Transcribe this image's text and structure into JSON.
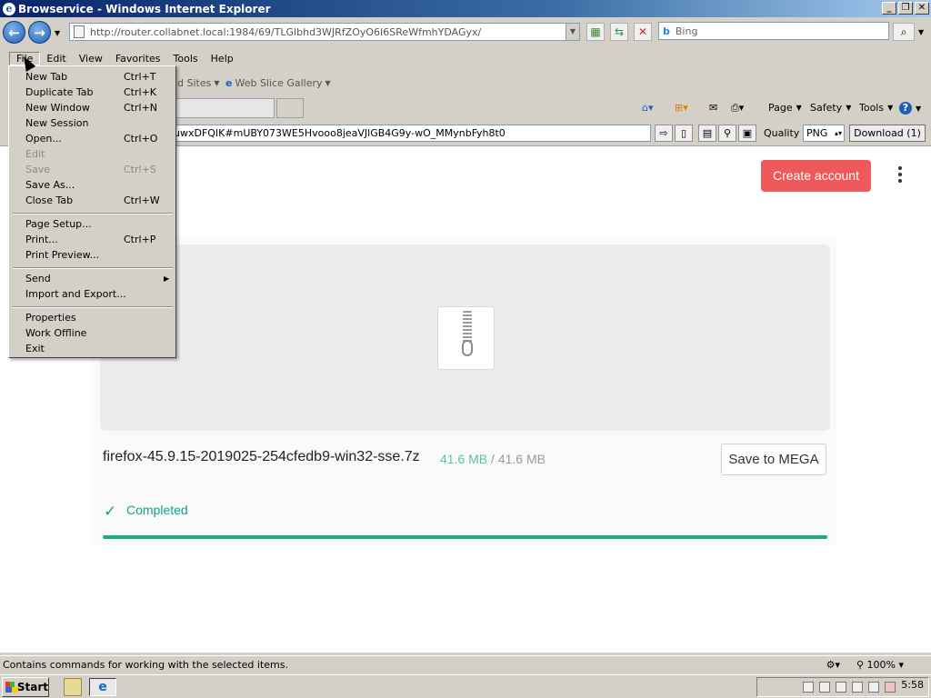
{
  "window": {
    "title": "Browservice - Windows Internet Explorer",
    "ie_letter": "e"
  },
  "address": {
    "url_host": "http://router.collabnet.local",
    "url_path": ":1984/69/TLGlbhd3WJRfZOyO6I6SReWfmhYDAGyx/"
  },
  "search": {
    "placeholder": "Bing"
  },
  "menubar": [
    "File",
    "Edit",
    "View",
    "Favorites",
    "Tools",
    "Help"
  ],
  "favorites": {
    "suggested_sites": "d Sites",
    "web_slice": "Web Slice Gallery"
  },
  "command": {
    "page": "Page",
    "safety": "Safety",
    "tools": "Tools",
    "help": "?"
  },
  "plugin": {
    "url": "uwxDFQIK#mUBY073WE5Hvooo8jeaVJlGB4G9y-wO_MMynbFyh8t0",
    "quality_label": "Quality",
    "quality_value": "PNG",
    "download_label": "Download (1)"
  },
  "page": {
    "create_account": "Create account",
    "filename": "firefox-45.9.15-2019025-254cfedb9-win32-sse.7z",
    "size_done": "41.6 MB",
    "size_sep": " / ",
    "size_total": "41.6 MB",
    "save_to_mega": "Save to MEGA",
    "status": "Completed",
    "progress_fraction": 1.0
  },
  "file_menu": {
    "items": [
      {
        "label": "New Tab",
        "shortcut": "Ctrl+T"
      },
      {
        "label": "Duplicate Tab",
        "shortcut": "Ctrl+K"
      },
      {
        "label": "New Window",
        "shortcut": "Ctrl+N"
      },
      {
        "label": "New Session",
        "shortcut": ""
      },
      {
        "label": "Open...",
        "shortcut": "Ctrl+O"
      },
      {
        "label": "Edit",
        "shortcut": ""
      },
      {
        "label": "Save",
        "shortcut": "Ctrl+S"
      },
      {
        "label": "Save As...",
        "shortcut": ""
      },
      {
        "label": "Close Tab",
        "shortcut": "Ctrl+W"
      },
      {
        "label": "Page Setup...",
        "shortcut": ""
      },
      {
        "label": "Print...",
        "shortcut": "Ctrl+P"
      },
      {
        "label": "Print Preview...",
        "shortcut": ""
      },
      {
        "label": "Send",
        "shortcut": ""
      },
      {
        "label": "Import and Export...",
        "shortcut": ""
      },
      {
        "label": "Properties",
        "shortcut": ""
      },
      {
        "label": "Work Offline",
        "shortcut": ""
      },
      {
        "label": "Exit",
        "shortcut": ""
      }
    ]
  },
  "statusbar": {
    "text": "Contains commands for working with the selected items.",
    "zoom": "100%"
  },
  "taskbar": {
    "start": "Start",
    "clock": "5:58"
  },
  "colors": {
    "accent_red": "#f0595a",
    "mega_green": "#13a085",
    "progress_green": "#13b07d"
  }
}
